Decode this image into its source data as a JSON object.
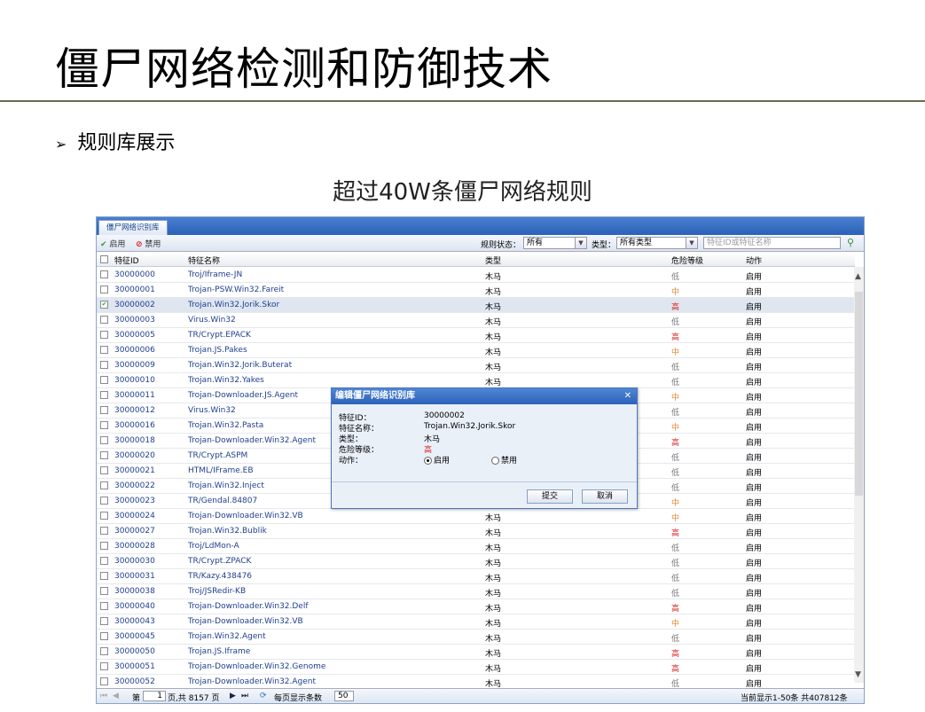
{
  "slide": {
    "title": "僵尸网络检测和防御技术",
    "bullet": "规则库展示",
    "subtitle": "超过40W条僵尸网络规则"
  },
  "app": {
    "tab": "僵尸网络识别库",
    "toolbar": {
      "enable_label": "启用",
      "disable_label": "禁用",
      "status_label": "规则状态：",
      "status_value": "所有",
      "type_label": "类型：",
      "type_value": "所有类型",
      "search_placeholder": "特征ID或特征名称"
    },
    "columns": [
      "特征ID",
      "特征名称",
      "类型",
      "危险等级",
      "动作"
    ],
    "rows": [
      {
        "id": "30000000",
        "name": "Troj/Iframe-JN",
        "type": "木马",
        "level": "低",
        "action": "启用",
        "checked": false
      },
      {
        "id": "30000001",
        "name": "Trojan-PSW.Win32.Fareit",
        "type": "木马",
        "level": "中",
        "action": "启用",
        "checked": false
      },
      {
        "id": "30000002",
        "name": "Trojan.Win32.Jorik.Skor",
        "type": "木马",
        "level": "高",
        "action": "启用",
        "checked": true
      },
      {
        "id": "30000003",
        "name": "Virus.Win32",
        "type": "木马",
        "level": "低",
        "action": "启用",
        "checked": false
      },
      {
        "id": "30000005",
        "name": "TR/Crypt.EPACK",
        "type": "木马",
        "level": "高",
        "action": "启用",
        "checked": false
      },
      {
        "id": "30000006",
        "name": "Trojan.JS.Pakes",
        "type": "木马",
        "level": "中",
        "action": "启用",
        "checked": false
      },
      {
        "id": "30000009",
        "name": "Trojan.Win32.Jorik.Buterat",
        "type": "木马",
        "level": "低",
        "action": "启用",
        "checked": false
      },
      {
        "id": "30000010",
        "name": "Trojan.Win32.Yakes",
        "type": "木马",
        "level": "低",
        "action": "启用",
        "checked": false
      },
      {
        "id": "30000011",
        "name": "Trojan-Downloader.JS.Agent",
        "type": "",
        "level": "中",
        "action": "启用",
        "checked": false
      },
      {
        "id": "30000012",
        "name": "Virus.Win32",
        "type": "",
        "level": "低",
        "action": "启用",
        "checked": false
      },
      {
        "id": "30000016",
        "name": "Trojan.Win32.Pasta",
        "type": "",
        "level": "中",
        "action": "启用",
        "checked": false
      },
      {
        "id": "30000018",
        "name": "Trojan-Downloader.Win32.Agent",
        "type": "",
        "level": "高",
        "action": "启用",
        "checked": false
      },
      {
        "id": "30000020",
        "name": "TR/Crypt.ASPM",
        "type": "",
        "level": "低",
        "action": "启用",
        "checked": false
      },
      {
        "id": "30000021",
        "name": "HTML/IFrame.EB",
        "type": "",
        "level": "低",
        "action": "启用",
        "checked": false
      },
      {
        "id": "30000022",
        "name": "Trojan.Win32.Inject",
        "type": "",
        "level": "低",
        "action": "启用",
        "checked": false
      },
      {
        "id": "30000023",
        "name": "TR/Gendal.84807",
        "type": "",
        "level": "中",
        "action": "启用",
        "checked": false
      },
      {
        "id": "30000024",
        "name": "Trojan-Downloader.Win32.VB",
        "type": "木马",
        "level": "中",
        "action": "启用",
        "checked": false
      },
      {
        "id": "30000027",
        "name": "Trojan.Win32.Bublik",
        "type": "木马",
        "level": "高",
        "action": "启用",
        "checked": false
      },
      {
        "id": "30000028",
        "name": "Troj/LdMon-A",
        "type": "木马",
        "level": "低",
        "action": "启用",
        "checked": false
      },
      {
        "id": "30000030",
        "name": "TR/Crypt.ZPACK",
        "type": "木马",
        "level": "低",
        "action": "启用",
        "checked": false
      },
      {
        "id": "30000031",
        "name": "TR/Kazy.438476",
        "type": "木马",
        "level": "低",
        "action": "启用",
        "checked": false
      },
      {
        "id": "30000038",
        "name": "Troj/JSRedir-KB",
        "type": "木马",
        "level": "低",
        "action": "启用",
        "checked": false
      },
      {
        "id": "30000040",
        "name": "Trojan-Downloader.Win32.Delf",
        "type": "木马",
        "level": "高",
        "action": "启用",
        "checked": false
      },
      {
        "id": "30000043",
        "name": "Trojan-Downloader.Win32.VB",
        "type": "木马",
        "level": "中",
        "action": "启用",
        "checked": false
      },
      {
        "id": "30000045",
        "name": "Trojan.Win32.Agent",
        "type": "木马",
        "level": "低",
        "action": "启用",
        "checked": false
      },
      {
        "id": "30000050",
        "name": "Trojan.JS.Iframe",
        "type": "木马",
        "level": "高",
        "action": "启用",
        "checked": false
      },
      {
        "id": "30000051",
        "name": "Trojan-Downloader.Win32.Genome",
        "type": "木马",
        "level": "高",
        "action": "启用",
        "checked": false
      },
      {
        "id": "30000052",
        "name": "Trojan-Downloader.Win32.Agent",
        "type": "木马",
        "level": "低",
        "action": "启用",
        "checked": false
      }
    ],
    "pager": {
      "page_prefix": "第",
      "page_value": "1",
      "page_suffix": "页,共 8157 页",
      "per_page_label": "每页显示条数",
      "per_page_value": "50",
      "summary": "当前显示1-50条 共407812条"
    },
    "dialog": {
      "title": "编辑僵尸网络识别库",
      "fields": [
        {
          "label": "特征ID：",
          "value": "30000002"
        },
        {
          "label": "特征名称：",
          "value": "Trojan.Win32.Jorik.Skor"
        },
        {
          "label": "类型：",
          "value": "木马"
        },
        {
          "label": "危险等级：",
          "value": "高"
        },
        {
          "label": "动作：",
          "value": ""
        }
      ],
      "radio_enable": "启用",
      "radio_disable": "禁用",
      "submit": "提交",
      "cancel": "取消"
    }
  }
}
